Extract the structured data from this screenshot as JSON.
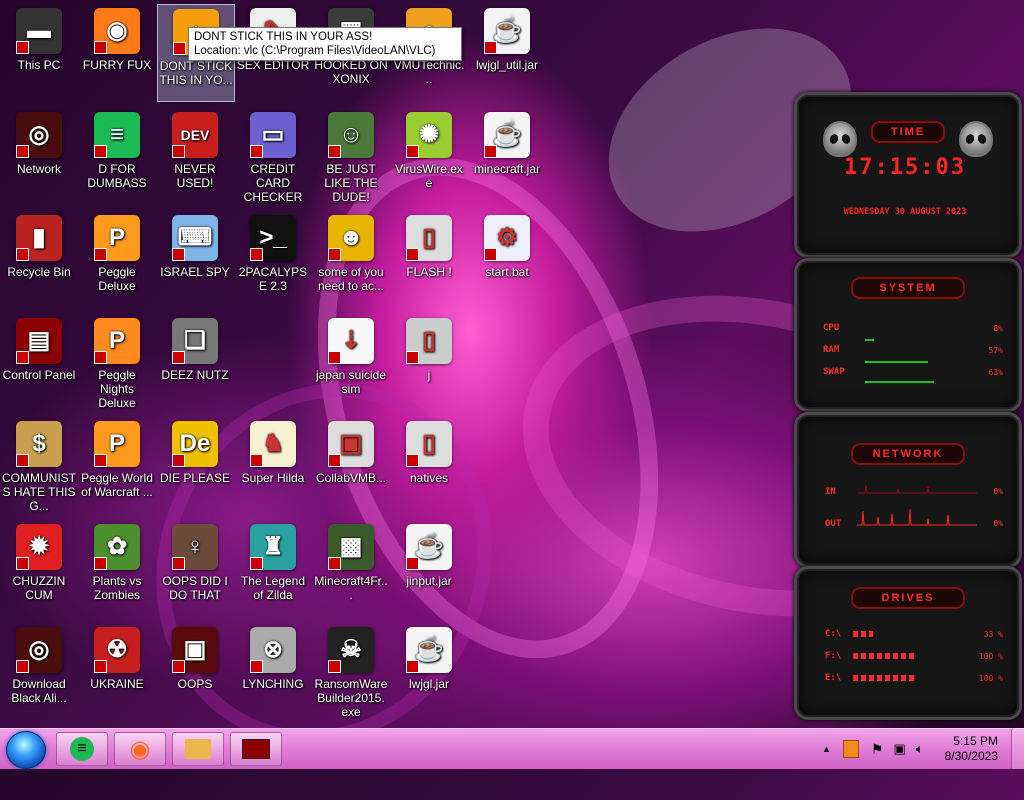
{
  "desktop": {
    "icons": [
      {
        "label": "This PC",
        "glyph": "▬",
        "bg": "#333"
      },
      {
        "label": "FURRY FUX",
        "glyph": "◉",
        "bg": "#ff7b1a"
      },
      {
        "label": "DONT STICK THIS IN YO...",
        "glyph": "▲",
        "bg": "#f59e0b"
      },
      {
        "label": "SEX EDITOR",
        "glyph": "✎",
        "bg": "#eee"
      },
      {
        "label": "HOOKED ON XONIX",
        "glyph": "▦",
        "bg": "#3b3b3b"
      },
      {
        "label": "VMUTechnic...",
        "glyph": "●",
        "bg": "#f0a020"
      },
      {
        "label": "lwjgl_util.jar",
        "glyph": "☕",
        "bg": "#f4f4f4"
      },
      {
        "label": "Network",
        "glyph": "◎",
        "bg": "#4a0d0d"
      },
      {
        "label": "D FOR DUMBASS",
        "glyph": "≡",
        "bg": "#1db954"
      },
      {
        "label": "NEVER USED!",
        "glyph": "DEV",
        "bg": "#c81e1e"
      },
      {
        "label": "CREDIT CARD CHECKER",
        "glyph": "▭",
        "bg": "#6d5fcf"
      },
      {
        "label": "BE JUST LIKE THE DUDE!",
        "glyph": "☺",
        "bg": "#4a7a3a"
      },
      {
        "label": "VirusWire.exe",
        "glyph": "✺",
        "bg": "#9acd32"
      },
      {
        "label": "minecraft.jar",
        "glyph": "☕",
        "bg": "#f4f4f4"
      },
      {
        "label": "Recycle Bin",
        "glyph": "▮",
        "bg": "#b22"
      },
      {
        "label": "Peggle Deluxe",
        "glyph": "P",
        "bg": "#ff9a1f"
      },
      {
        "label": "ISRAEL SPY",
        "glyph": "⌨",
        "bg": "#7fb4e8"
      },
      {
        "label": "2PACALYPSE 2.3",
        "glyph": ">_",
        "bg": "#111"
      },
      {
        "label": "some of you need to ac...",
        "glyph": "☻",
        "bg": "#e8b400"
      },
      {
        "label": "FLASH !",
        "glyph": "▯",
        "bg": "#ddd"
      },
      {
        "label": "start.bat",
        "glyph": "⚙",
        "bg": "#eef"
      },
      {
        "label": "Control Panel",
        "glyph": "▤",
        "bg": "#8b0000"
      },
      {
        "label": "Peggle Nights Deluxe",
        "glyph": "P",
        "bg": "#ff8a1f"
      },
      {
        "label": "DEEZ NUTZ",
        "glyph": "❏",
        "bg": "#777"
      },
      {
        "label": "japan suicide sim",
        "glyph": "⇣",
        "bg": "#f8f8f8"
      },
      {
        "label": "j",
        "glyph": "▯",
        "bg": "#ccc"
      },
      {
        "label": "COMMUNISTS HATE THIS G...",
        "glyph": "$",
        "bg": "#c8a050"
      },
      {
        "label": "Peggle World of Warcraft ...",
        "glyph": "P",
        "bg": "#ff9a1f"
      },
      {
        "label": "DIE PLEASE",
        "glyph": "De",
        "bg": "#f0c000"
      },
      {
        "label": "Super Hilda",
        "glyph": "♞",
        "bg": "#f5f0d0"
      },
      {
        "label": "CollabVMB...",
        "glyph": "▣",
        "bg": "#ddd"
      },
      {
        "label": "natives",
        "glyph": "▯",
        "bg": "#ddd"
      },
      {
        "label": "CHUZZIN CUM",
        "glyph": "✹",
        "bg": "#e02020"
      },
      {
        "label": "Plants vs Zombies",
        "glyph": "✿",
        "bg": "#4c8f2f"
      },
      {
        "label": "OOPS DID I DO THAT",
        "glyph": "♀",
        "bg": "#6b4a3a"
      },
      {
        "label": "The Legend of Zilda",
        "glyph": "♜",
        "bg": "#2aa0a0"
      },
      {
        "label": "Minecraft4Fr...",
        "glyph": "▩",
        "bg": "#3a5a2a"
      },
      {
        "label": "jinput.jar",
        "glyph": "☕",
        "bg": "#f4f4f4"
      },
      {
        "label": "Download Black Ali...",
        "glyph": "◎",
        "bg": "#4a0d0d"
      },
      {
        "label": "UKRAINE",
        "glyph": "☢",
        "bg": "#c81e1e"
      },
      {
        "label": "OOPS",
        "glyph": "▣",
        "bg": "#5a0a0a"
      },
      {
        "label": "LYNCHING",
        "glyph": "⊗",
        "bg": "#aaa"
      },
      {
        "label": "RansomWareBuilder2015.exe",
        "glyph": "☠",
        "bg": "#222"
      },
      {
        "label": "lwjgl.jar",
        "glyph": "☕",
        "bg": "#f4f4f4"
      }
    ],
    "tooltip": {
      "line1": "DONT STICK THIS IN YOUR ASS!",
      "line2": "Location: vlc (C:\\Program Files\\VideoLAN\\VLC)"
    }
  },
  "gadgets": {
    "time": {
      "title": "TIME",
      "time": "17:15:03",
      "date": "WEDNESDAY 30 AUGUST 2023"
    },
    "system": {
      "title": "SYSTEM",
      "rows": [
        {
          "label": "CPU",
          "value": "8%",
          "level": 0.08
        },
        {
          "label": "RAM",
          "value": "57%",
          "level": 0.57
        },
        {
          "label": "SWAP",
          "value": "63%",
          "level": 0.63
        }
      ]
    },
    "network": {
      "title": "NETWORK",
      "rows": [
        {
          "label": "IN",
          "value": "0%"
        },
        {
          "label": "OUT",
          "value": "0%"
        }
      ]
    },
    "drives": {
      "title": "DRIVES",
      "rows": [
        {
          "label": "C:\\",
          "value": "33 %",
          "level": 0.33
        },
        {
          "label": "F:\\",
          "value": "100 %",
          "level": 1.0
        },
        {
          "label": "E:\\",
          "value": "100 %",
          "level": 1.0
        }
      ]
    }
  },
  "taskbar": {
    "pinned": [
      {
        "name": "spotify",
        "glyph": "≡",
        "color": "#1db954"
      },
      {
        "name": "firefox",
        "glyph": "◉",
        "color": "#ff6a1a"
      },
      {
        "name": "explorer",
        "glyph": "▭",
        "color": "#e8b94a"
      },
      {
        "name": "control-panel",
        "glyph": "▤",
        "color": "#8b0000"
      }
    ],
    "tray": {
      "expand": "▲"
    },
    "clock": {
      "time": "5:15 PM",
      "date": "8/30/2023"
    }
  }
}
